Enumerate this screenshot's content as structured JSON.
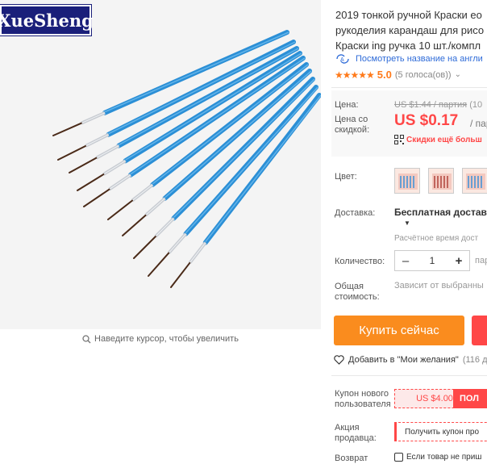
{
  "gallery": {
    "brand_logo": "XueSheng",
    "zoom_hint": "Наведите курсор, чтобы увеличить",
    "zoom_icon": "search-icon",
    "brush_color": "#2b8fd6"
  },
  "product": {
    "title_lines": [
      "2019 тонкой ручной Краски ео",
      "рукоделия карандаш для рисо",
      "Краски ing ручка 10 шт./компл"
    ],
    "translate_link": "Посмотреть название на англи",
    "rating": {
      "stars_text": "★★★★★",
      "value": "5.0",
      "count_text": "(5 голоса(ов))"
    }
  },
  "price": {
    "price_label": "Цена:",
    "old_price": "US $1.44 / партия",
    "old_price_extra": "(10",
    "discount_label_line1": "Цена со",
    "discount_label_line2": "скидкой:",
    "current_price": "US $0.17",
    "price_unit": "/ пар",
    "more_discounts": "Скидки ещё больш",
    "accent_color": "#ff4747"
  },
  "options": {
    "color_label": "Цвет:",
    "shipping_label": "Доставка:",
    "shipping_method": "Бесплатная доставка",
    "delivery_time": "Расчётное время дост",
    "quantity_label": "Количество:",
    "quantity_minus": "–",
    "quantity_value": "1",
    "quantity_plus": "+",
    "quantity_unit": "пар",
    "total_label_line1": "Общая",
    "total_label_line2": "стоимость:",
    "total_value": "Зависит от выбранны"
  },
  "actions": {
    "buy_now": "Купить сейчас",
    "wishlist": "Добавить в \"Мои желания\"",
    "wishlist_count": "(116 д"
  },
  "coupons": {
    "new_user_label_line1": "Купон нового",
    "new_user_label_line2": "пользователя",
    "new_user_amount": "US $4.00",
    "new_user_action": "ПОЛ",
    "seller_label_line1": "Акция",
    "seller_label_line2": "продавца:",
    "seller_action": "Получить купон про",
    "return_label": "Возврат",
    "return_text": "Если товар не приш"
  }
}
